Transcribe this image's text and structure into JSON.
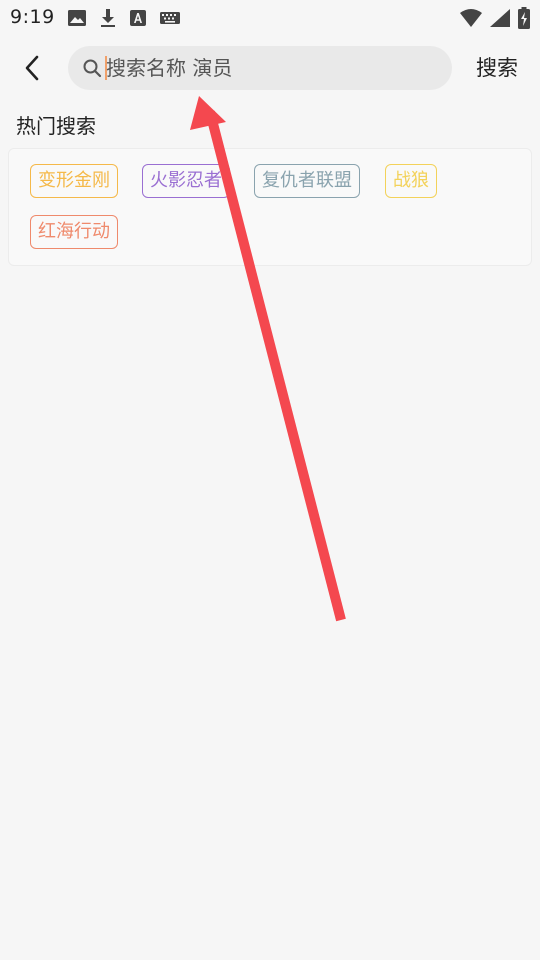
{
  "status_bar": {
    "time": "9:19",
    "left_icons": [
      "image-icon",
      "download-icon",
      "font-a-icon",
      "keyboard-icon"
    ],
    "right_icons": [
      "wifi-icon",
      "signal-icon",
      "battery-charging-icon"
    ]
  },
  "toolbar": {
    "back_icon": "chevron-left-icon",
    "search_placeholder": "搜索名称 演员",
    "search_value": "",
    "search_button_label": "搜索"
  },
  "hot_search": {
    "title": "热门搜索",
    "tags": [
      {
        "label": "变形金刚",
        "color": "#f5b94a"
      },
      {
        "label": "火影忍者",
        "color": "#9a6fd2"
      },
      {
        "label": "复仇者联盟",
        "color": "#8aa3ae"
      },
      {
        "label": "战狼",
        "color": "#f3d25a"
      },
      {
        "label": "红海行动",
        "color": "#ef8a6c"
      }
    ]
  },
  "colors": {
    "background": "#f6f6f6",
    "search_box": "#e9e9e9",
    "caret": "#f0a06a",
    "annotation_arrow": "#f4484f"
  }
}
